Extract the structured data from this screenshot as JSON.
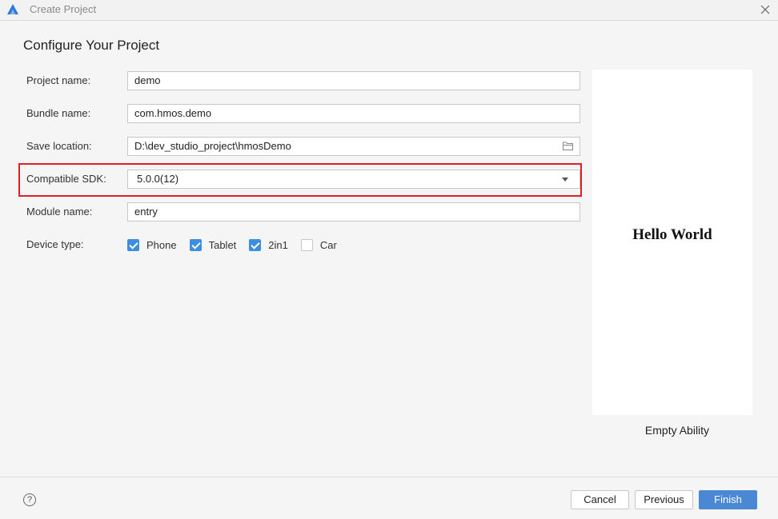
{
  "window": {
    "title": "Create Project"
  },
  "page": {
    "heading": "Configure Your Project"
  },
  "form": {
    "project_name": {
      "label": "Project name:",
      "value": "demo"
    },
    "bundle_name": {
      "label": "Bundle name:",
      "value": "com.hmos.demo"
    },
    "save_location": {
      "label": "Save location:",
      "value": "D:\\dev_studio_project\\hmosDemo"
    },
    "compatible_sdk": {
      "label": "Compatible SDK:",
      "value": "5.0.0(12)"
    },
    "module_name": {
      "label": "Module name:",
      "value": "entry"
    },
    "device_type": {
      "label": "Device type:",
      "options": [
        {
          "label": "Phone",
          "checked": true
        },
        {
          "label": "Tablet",
          "checked": true
        },
        {
          "label": "2in1",
          "checked": true
        },
        {
          "label": "Car",
          "checked": false
        }
      ]
    }
  },
  "preview": {
    "text": "Hello World",
    "template_name": "Empty Ability"
  },
  "footer": {
    "help_glyph": "?",
    "cancel": "Cancel",
    "previous": "Previous",
    "finish": "Finish"
  },
  "colors": {
    "accent": "#4a88d4",
    "highlight": "#e02020",
    "checkbox": "#3c8ee0"
  }
}
